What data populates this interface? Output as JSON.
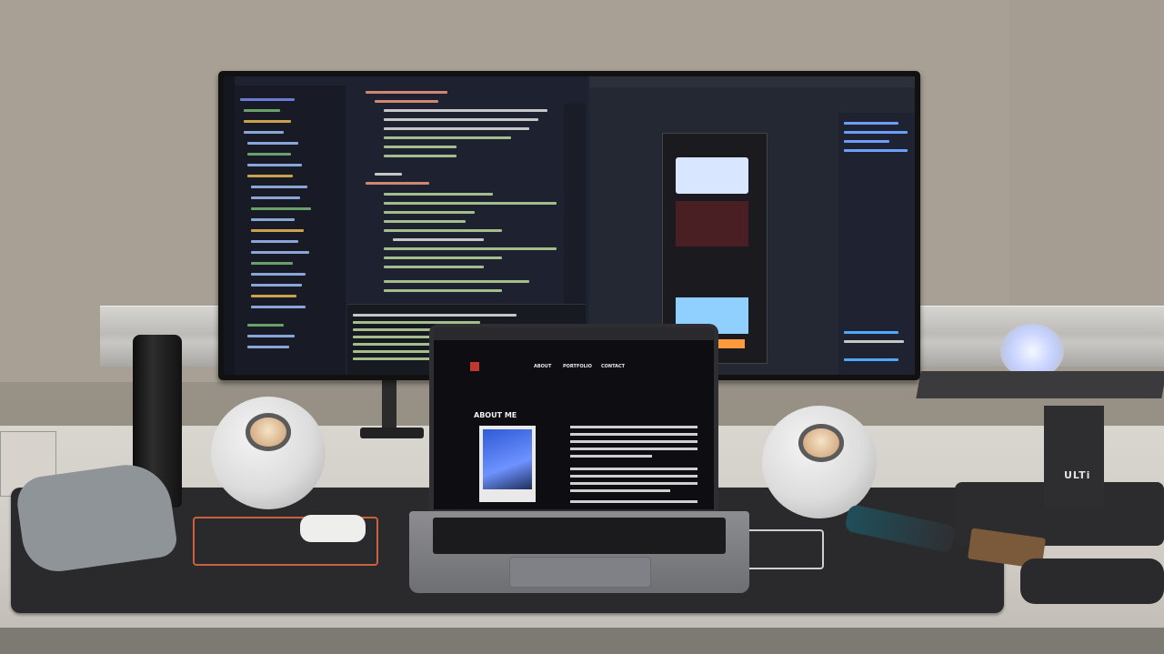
{
  "scene": {
    "description_colors": {
      "wall": "#a39b90",
      "desk": "#d9d6d0",
      "mat": "#2a2a2c",
      "accent_orange": "#c9603e",
      "screen_bg": "#1d2433"
    }
  },
  "laptop_site": {
    "nav_about": "ABOUT",
    "nav_portfolio": "PORTFOLIO",
    "nav_contact": "CONTACT",
    "heading": "ABOUT ME"
  },
  "stand_brand": "ULTi"
}
